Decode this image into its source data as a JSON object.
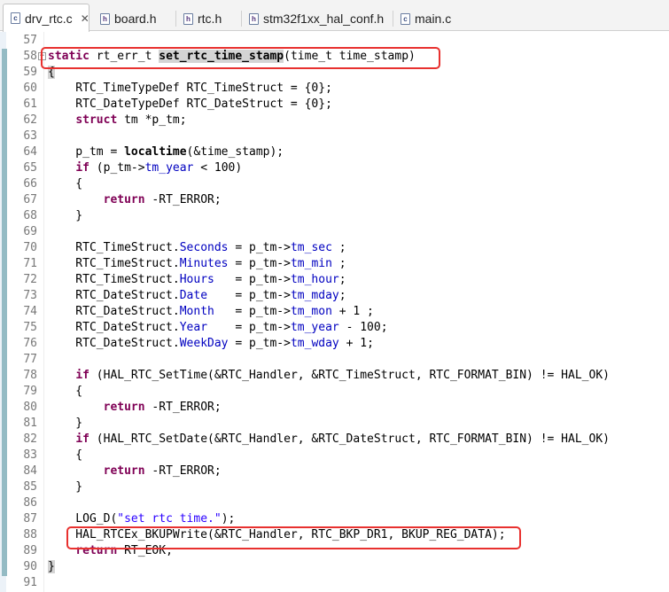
{
  "tabs": [
    {
      "label": "drv_rtc.c",
      "icon": "c-file-icon",
      "icon_letter": "c",
      "active": true,
      "close": "✕"
    },
    {
      "label": "board.h",
      "icon": "h-file-icon",
      "icon_letter": "h",
      "active": false
    },
    {
      "label": "rtc.h",
      "icon": "h-file-icon",
      "icon_letter": "h",
      "active": false
    },
    {
      "label": "stm32f1xx_hal_conf.h",
      "icon": "h-file-icon",
      "icon_letter": "h",
      "active": false
    },
    {
      "label": "main.c",
      "icon": "c-file-icon",
      "icon_letter": "c",
      "active": false
    }
  ],
  "editor": {
    "line_numbers": [
      "57",
      "58",
      "59",
      "60",
      "61",
      "62",
      "63",
      "64",
      "65",
      "66",
      "67",
      "68",
      "69",
      "70",
      "71",
      "72",
      "73",
      "74",
      "75",
      "76",
      "77",
      "78",
      "79",
      "80",
      "81",
      "82",
      "83",
      "84",
      "85",
      "86",
      "87",
      "88",
      "89",
      "90",
      "91"
    ],
    "code": {
      "l58": {
        "kw": "static",
        "type": "rt_err_t",
        "fn": "set_rtc_time_stamp",
        "rest": "(time_t time_stamp)"
      },
      "l59": "{",
      "l60": "    RTC_TimeTypeDef RTC_TimeStruct = {0};",
      "l61": "    RTC_DateTypeDef RTC_DateStruct = {0};",
      "l62": {
        "kw": "struct",
        "rest": " tm *p_tm;"
      },
      "l64": {
        "pre": "    p_tm = ",
        "fn": "localtime",
        "rest": "(&time_stamp);"
      },
      "l65": {
        "kw": "if",
        "pre": " (p_tm->",
        "fld": "tm_year",
        "rest": " < 100)"
      },
      "l66": "    {",
      "l67": {
        "kw": "return",
        "rest": " -RT_ERROR;"
      },
      "l68": "    }",
      "l70": {
        "pre": "    RTC_TimeStruct.",
        "f1": "Seconds",
        "mid": " = p_tm->",
        "f2": "tm_sec",
        "rest": " ;"
      },
      "l71": {
        "pre": "    RTC_TimeStruct.",
        "f1": "Minutes",
        "mid": " = p_tm->",
        "f2": "tm_min",
        "rest": " ;"
      },
      "l72": {
        "pre": "    RTC_TimeStruct.",
        "f1": "Hours",
        "mid": "   = p_tm->",
        "f2": "tm_hour",
        "rest": ";"
      },
      "l73": {
        "pre": "    RTC_DateStruct.",
        "f1": "Date",
        "mid": "    = p_tm->",
        "f2": "tm_mday",
        "rest": ";"
      },
      "l74": {
        "pre": "    RTC_DateStruct.",
        "f1": "Month",
        "mid": "   = p_tm->",
        "f2": "tm_mon",
        "rest": " + 1 ;"
      },
      "l75": {
        "pre": "    RTC_DateStruct.",
        "f1": "Year",
        "mid": "    = p_tm->",
        "f2": "tm_year",
        "rest": " - 100;"
      },
      "l76": {
        "pre": "    RTC_DateStruct.",
        "f1": "WeekDay",
        "mid": " = p_tm->",
        "f2": "tm_wday",
        "rest": " + 1;"
      },
      "l78": {
        "kw": "if",
        "rest": " (HAL_RTC_SetTime(&RTC_Handler, &RTC_TimeStruct, RTC_FORMAT_BIN) != HAL_OK)"
      },
      "l79": "    {",
      "l80": {
        "kw": "return",
        "rest": " -RT_ERROR;"
      },
      "l81": "    }",
      "l82": {
        "kw": "if",
        "rest": " (HAL_RTC_SetDate(&RTC_Handler, &RTC_DateStruct, RTC_FORMAT_BIN) != HAL_OK)"
      },
      "l83": "    {",
      "l84": {
        "kw": "return",
        "rest": " -RT_ERROR;"
      },
      "l85": "    }",
      "l87": {
        "pre": "    LOG_D(",
        "str": "\"set rtc time.\"",
        "rest": ");"
      },
      "l88": "    HAL_RTCEx_BKUPWrite(&RTC_Handler, RTC_BKP_DR1, BKUP_REG_DATA);",
      "l89": {
        "kw": "return",
        "rest": " RT_EOK;"
      },
      "l90": "}"
    }
  },
  "annotations": {
    "highlight_color": "#e8312f"
  }
}
